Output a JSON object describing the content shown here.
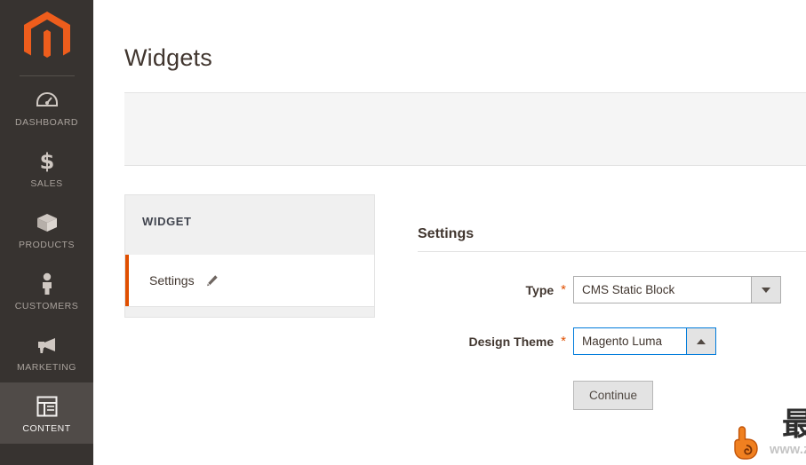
{
  "sidebar": {
    "logo_icon": "magento-logo-icon",
    "brand_color": "#ee5d1c",
    "items": [
      {
        "label": "DASHBOARD",
        "icon": "dashboard-gauge-icon",
        "active": false
      },
      {
        "label": "SALES",
        "icon": "dollar-sign-icon",
        "active": false
      },
      {
        "label": "PRODUCTS",
        "icon": "box-package-icon",
        "active": false
      },
      {
        "label": "CUSTOMERS",
        "icon": "person-icon",
        "active": false
      },
      {
        "label": "MARKETING",
        "icon": "megaphone-icon",
        "active": false
      },
      {
        "label": "CONTENT",
        "icon": "layout-panel-icon",
        "active": true
      }
    ]
  },
  "header": {
    "title": "Widgets"
  },
  "tab_panel": {
    "header": "WIDGET",
    "items": [
      {
        "label": "Settings",
        "icon": "pencil-icon",
        "active": true
      }
    ]
  },
  "settings": {
    "section_title": "Settings",
    "required_marker": "*",
    "fields": [
      {
        "label": "Type",
        "required": true,
        "value": "CMS Static Block",
        "arrow_icon": "chevron-down-icon",
        "focused": false
      },
      {
        "label": "Design Theme",
        "required": true,
        "value": "Magento Luma",
        "arrow_icon": "chevron-up-icon",
        "focused": true
      }
    ],
    "continue_label": "Continue"
  },
  "overlay": {
    "cursor_icon": "pointing-hand-cursor",
    "watermark_text": "最模板",
    "watermark_url": "www.zuimoban.com"
  },
  "colors": {
    "accent_orange": "#e04f00",
    "focus_blue": "#007bdb",
    "sidebar_bg": "#373330"
  }
}
